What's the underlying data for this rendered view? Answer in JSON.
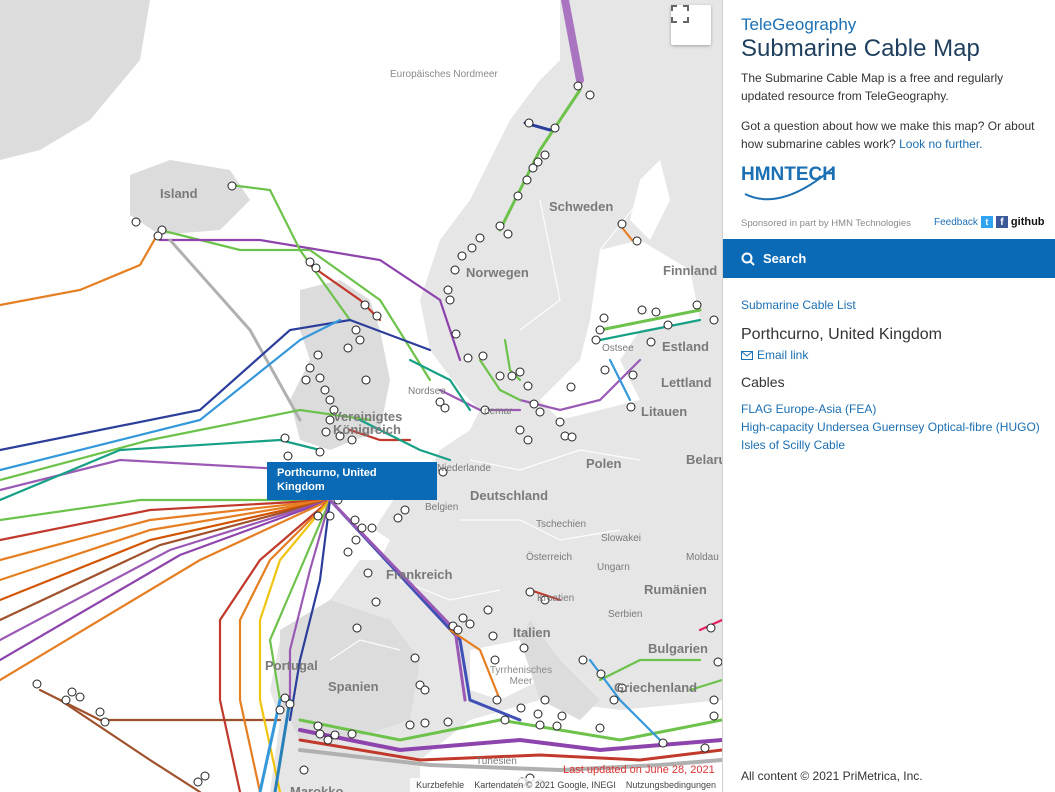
{
  "map": {
    "labels": {
      "sea_north": "Europäisches Nordmeer",
      "island": "Island",
      "schweden": "Schweden",
      "norwegen": "Norwegen",
      "finnland": "Finnland",
      "estland": "Estland",
      "lettland": "Lettland",
      "litauen": "Litauen",
      "ostsee": "Ostsee",
      "nordsee": "Nordsee",
      "vk1": "Vereinigtes",
      "vk2": "Königreich",
      "polen": "Polen",
      "belarus": "Belaru",
      "deutschland": "Deutschland",
      "niederlande": "Niederlande",
      "belgien": "Belgien",
      "tschechien": "Tschechien",
      "slowakei": "Slowakei",
      "oesterreich": "Österreich",
      "ungarn": "Ungarn",
      "moldau": "Moldau",
      "rumaenien": "Rumänien",
      "frankreich": "Frankreich",
      "kroatien": "Kroatien",
      "serbien": "Serbien",
      "italien": "Italien",
      "bulgarien": "Bulgarien",
      "griechenland": "Griechenland",
      "portugal": "Portugal",
      "spanien": "Spanien",
      "tyrrhen": "Tyrrhenisches Meer",
      "tunesien": "Tunesien",
      "marokko": "Marokko",
      "dnemark": "nemar"
    },
    "popup": "Porthcurno, United Kingdom",
    "last_updated": "Last updated on June 28, 2021",
    "attribution": {
      "shortcuts": "Kurzbefehle",
      "mapdata": "Kartendaten © 2021 Google, INEGI",
      "terms": "Nutzungsbedingungen"
    },
    "fullscreen_icon": "fullscreen-icon"
  },
  "panel": {
    "brand": "TeleGeography",
    "title": "Submarine Cable Map",
    "intro": "The Submarine Cable Map is a free and regularly updated resource from TeleGeography.",
    "question": "Got a question about how we make this map? Or about how submarine cables work?",
    "question_link": "Look no further.",
    "sponsor_logo": "HMNTECH",
    "sponsor": "Sponsored in part by HMN Technologies",
    "feedback": "Feedback",
    "github": "github",
    "search": "Search",
    "cable_list_link": "Submarine Cable List",
    "place": "Porthcurno, United Kingdom",
    "email_link": "Email link",
    "cables_heading": "Cables",
    "cables": [
      "FLAG Europe-Asia (FEA)",
      "High-capacity Undersea Guernsey Optical-fibre (HUGO)",
      "Isles of Scilly Cable"
    ],
    "copyright": "All content © 2021 PriMetrica, Inc."
  },
  "colors": {
    "accent": "#0a6ab6",
    "water": "#ffffff",
    "land": "#e6e6e6"
  }
}
